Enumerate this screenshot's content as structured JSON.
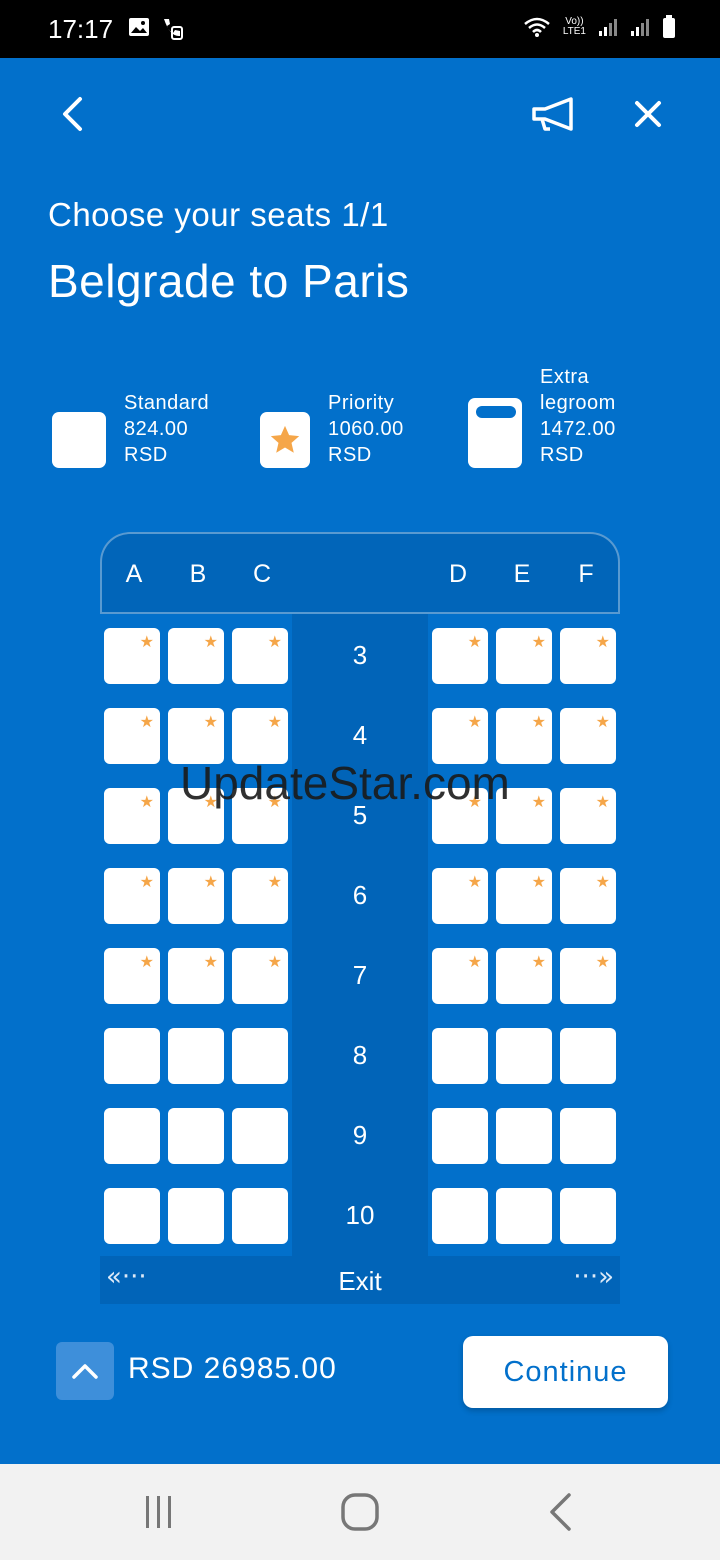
{
  "status_bar": {
    "time": "17:17",
    "network_label_top": "Vo))",
    "network_label_bottom": "LTE1"
  },
  "header": {
    "subtitle": "Choose your seats 1/1",
    "title": "Belgrade to Paris"
  },
  "legend": [
    {
      "lines": [
        "Standard",
        "824.00",
        "RSD"
      ],
      "icon": "blank-seat-icon"
    },
    {
      "lines": [
        "Priority",
        "1060.00",
        "RSD"
      ],
      "icon": "star-icon"
    },
    {
      "lines": [
        "Extra",
        "legroom",
        "1472.00",
        "RSD"
      ],
      "icon": "extra-legroom-seat-icon"
    }
  ],
  "seat_map": {
    "columns_left": [
      "A",
      "B",
      "C"
    ],
    "columns_right": [
      "D",
      "E",
      "F"
    ],
    "rows": [
      {
        "number": "3",
        "priority": true
      },
      {
        "number": "4",
        "priority": true
      },
      {
        "number": "5",
        "priority": true
      },
      {
        "number": "6",
        "priority": true
      },
      {
        "number": "7",
        "priority": true
      },
      {
        "number": "8",
        "priority": false
      },
      {
        "number": "9",
        "priority": false
      },
      {
        "number": "10",
        "priority": false
      }
    ],
    "exit_label": "Exit",
    "star_color": "#F5A649"
  },
  "watermark": "UpdateStar.com",
  "footer": {
    "total": "RSD 26985.00",
    "continue_label": "Continue"
  },
  "colors": {
    "background": "#0270CB",
    "aisle": "#0164B8"
  }
}
